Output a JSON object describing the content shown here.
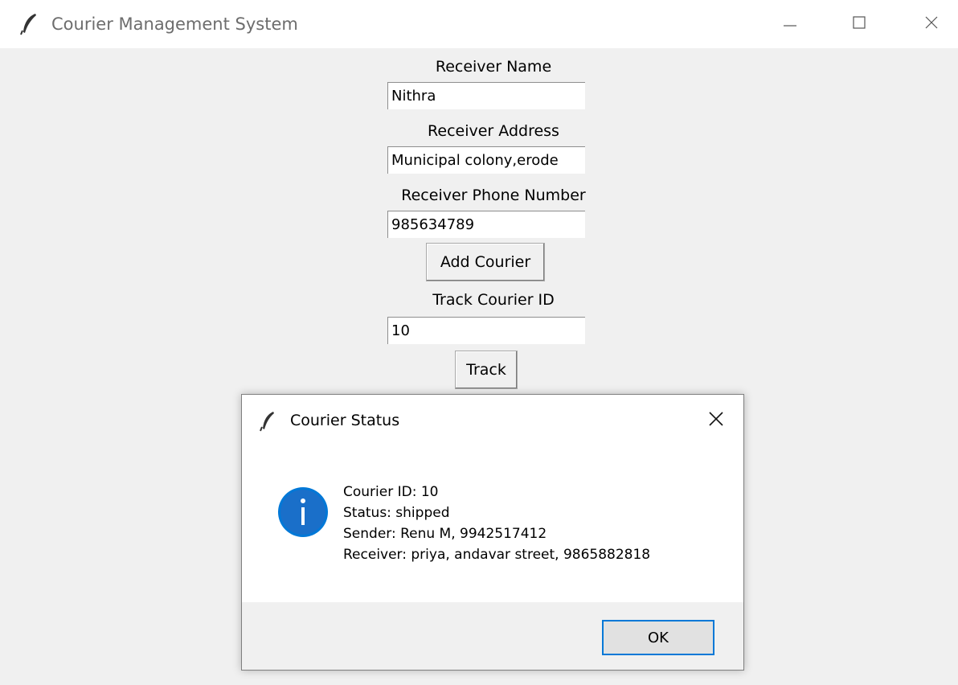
{
  "window": {
    "title": "Courier Management System",
    "icon": "feather-icon",
    "controls": [
      "minimize-icon",
      "maximize-icon",
      "close-icon"
    ]
  },
  "form": {
    "receiver_name_label": "Receiver Name",
    "receiver_name_value": "Nithra",
    "receiver_address_label": "Receiver Address",
    "receiver_address_value": "Municipal colony,erode",
    "receiver_phone_label": "Receiver Phone Number",
    "receiver_phone_value": "985634789",
    "add_button": "Add Courier",
    "track_id_label": "Track Courier ID",
    "track_id_value": "10",
    "track_button": "Track"
  },
  "dialog": {
    "title": "Courier Status",
    "icon": "info-icon",
    "accent_color": "#0078d7",
    "lines": [
      "Courier ID: 10",
      "Status: shipped",
      "Sender: Renu M, 9942517412",
      "Receiver: priya, andavar street, 9865882818"
    ],
    "ok_button": "OK"
  }
}
